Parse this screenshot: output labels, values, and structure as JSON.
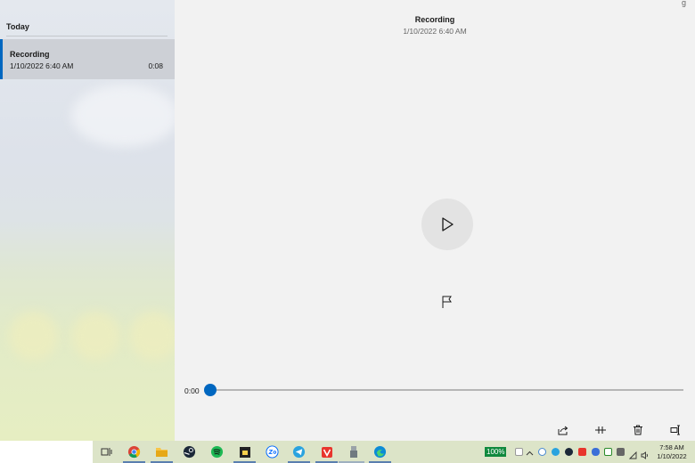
{
  "sidebar": {
    "group_label": "Today",
    "items": [
      {
        "name": "Recording",
        "date": "1/10/2022 6:40 AM",
        "duration": "0:08",
        "selected": true
      }
    ]
  },
  "main": {
    "title": "Recording",
    "date": "1/10/2022 6:40 AM",
    "corner_glyph": "g",
    "current_time": "0:00",
    "progress": 0
  },
  "toolbar": {
    "icons": [
      "share-icon",
      "trim-icon",
      "delete-icon",
      "rename-icon"
    ]
  },
  "taskbar": {
    "apps": [
      "task-view-icon",
      "chrome-icon",
      "file-explorer-icon",
      "steam-icon",
      "spotify-icon",
      "sticky-notes-icon",
      "zalo-icon",
      "telegram-icon",
      "vivaldi-icon",
      "usb-app-icon",
      "edge-icon"
    ],
    "battery_label": "100%",
    "clock_time": "7:58 AM",
    "clock_date": "1/10/2022"
  },
  "colors": {
    "accent": "#0067c0",
    "sidebar_selected": "#cdd0d6",
    "battery_green": "#10893e"
  }
}
